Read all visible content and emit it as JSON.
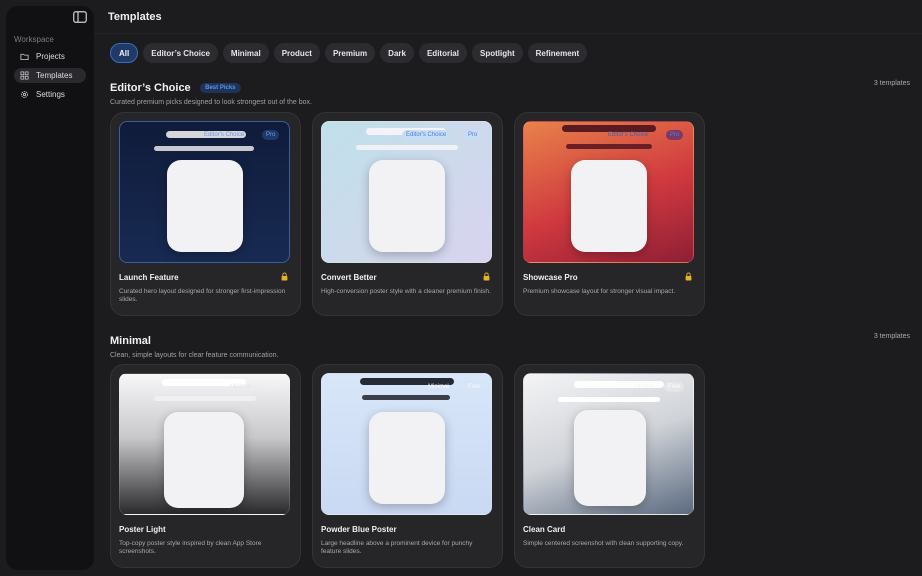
{
  "sidebar": {
    "workspace_label": "Workspace",
    "items": [
      {
        "label": "Projects",
        "icon": "folder-icon"
      },
      {
        "label": "Templates",
        "icon": "grid-icon"
      },
      {
        "label": "Settings",
        "icon": "gear-icon"
      }
    ],
    "active": "Templates"
  },
  "header": {
    "title": "Templates"
  },
  "filters": [
    "All",
    "Editor’s Choice",
    "Minimal",
    "Product",
    "Premium",
    "Dark",
    "Editorial",
    "Spotlight",
    "Refinement"
  ],
  "active_filter": "All",
  "sections": [
    {
      "title": "Editor’s Choice",
      "badge": "Best Picks",
      "subtitle": "Curated premium picks designed to look strongest out of the box.",
      "count": "3 templates",
      "cards": [
        {
          "name": "Launch Feature",
          "desc": "Curated hero layout designed for stronger first-impression slides.",
          "tag1": "Editor's Choice",
          "tag2": "Pro",
          "locked": true
        },
        {
          "name": "Convert Better",
          "desc": "High-conversion poster style with a cleaner premium finish.",
          "tag1": "Editor's Choice",
          "tag2": "Pro",
          "locked": true
        },
        {
          "name": "Showcase Pro",
          "desc": "Premium showcase layout for stronger visual impact.",
          "tag1": "Editor's Choice",
          "tag2": "Pro",
          "locked": true
        }
      ]
    },
    {
      "title": "Minimal",
      "badge": "",
      "subtitle": "Clean, simple layouts for clear feature communication.",
      "count": "3 templates",
      "cards": [
        {
          "name": "Poster Light",
          "desc": "Top-copy poster style inspired by clean App Store screenshots.",
          "tag1": "Minimal",
          "tag2": "Free",
          "locked": false
        },
        {
          "name": "Powder Blue Poster",
          "desc": "Large headline above a prominent device for punchy feature slides.",
          "tag1": "Minimal",
          "tag2": "Free",
          "locked": false
        },
        {
          "name": "Clean Card",
          "desc": "Simple centered screenshot with clean supporting copy.",
          "tag1": "Minimal",
          "tag2": "Free",
          "locked": false
        }
      ]
    }
  ],
  "colors": {
    "accent": "#3b6cc0",
    "badge_text": "#5b93ea",
    "background": "#1c1c1e",
    "sidebar": "#111113",
    "card": "#262628"
  }
}
